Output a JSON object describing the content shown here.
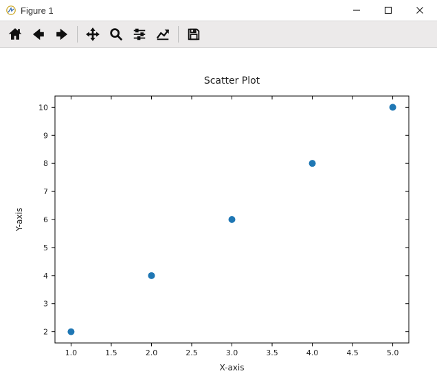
{
  "window": {
    "title": "Figure 1"
  },
  "toolbar": {
    "home": "Home",
    "back": "Back",
    "forward": "Forward",
    "pan": "Pan",
    "zoom": "Zoom",
    "configure": "Configure subplots",
    "editaxes": "Edit axis/curve",
    "save": "Save"
  },
  "chart_data": {
    "type": "scatter",
    "title": "Scatter Plot",
    "xlabel": "X-axis",
    "ylabel": "Y-axis",
    "x": [
      1,
      2,
      3,
      4,
      5
    ],
    "y": [
      2,
      4,
      6,
      8,
      10
    ],
    "xticks": [
      1.0,
      1.5,
      2.0,
      2.5,
      3.0,
      3.5,
      4.0,
      4.5,
      5.0
    ],
    "yticks": [
      2,
      3,
      4,
      5,
      6,
      7,
      8,
      9,
      10
    ],
    "xlim": [
      0.8,
      5.2
    ],
    "ylim": [
      1.6,
      10.4
    ],
    "marker_color": "#1f77b4"
  }
}
